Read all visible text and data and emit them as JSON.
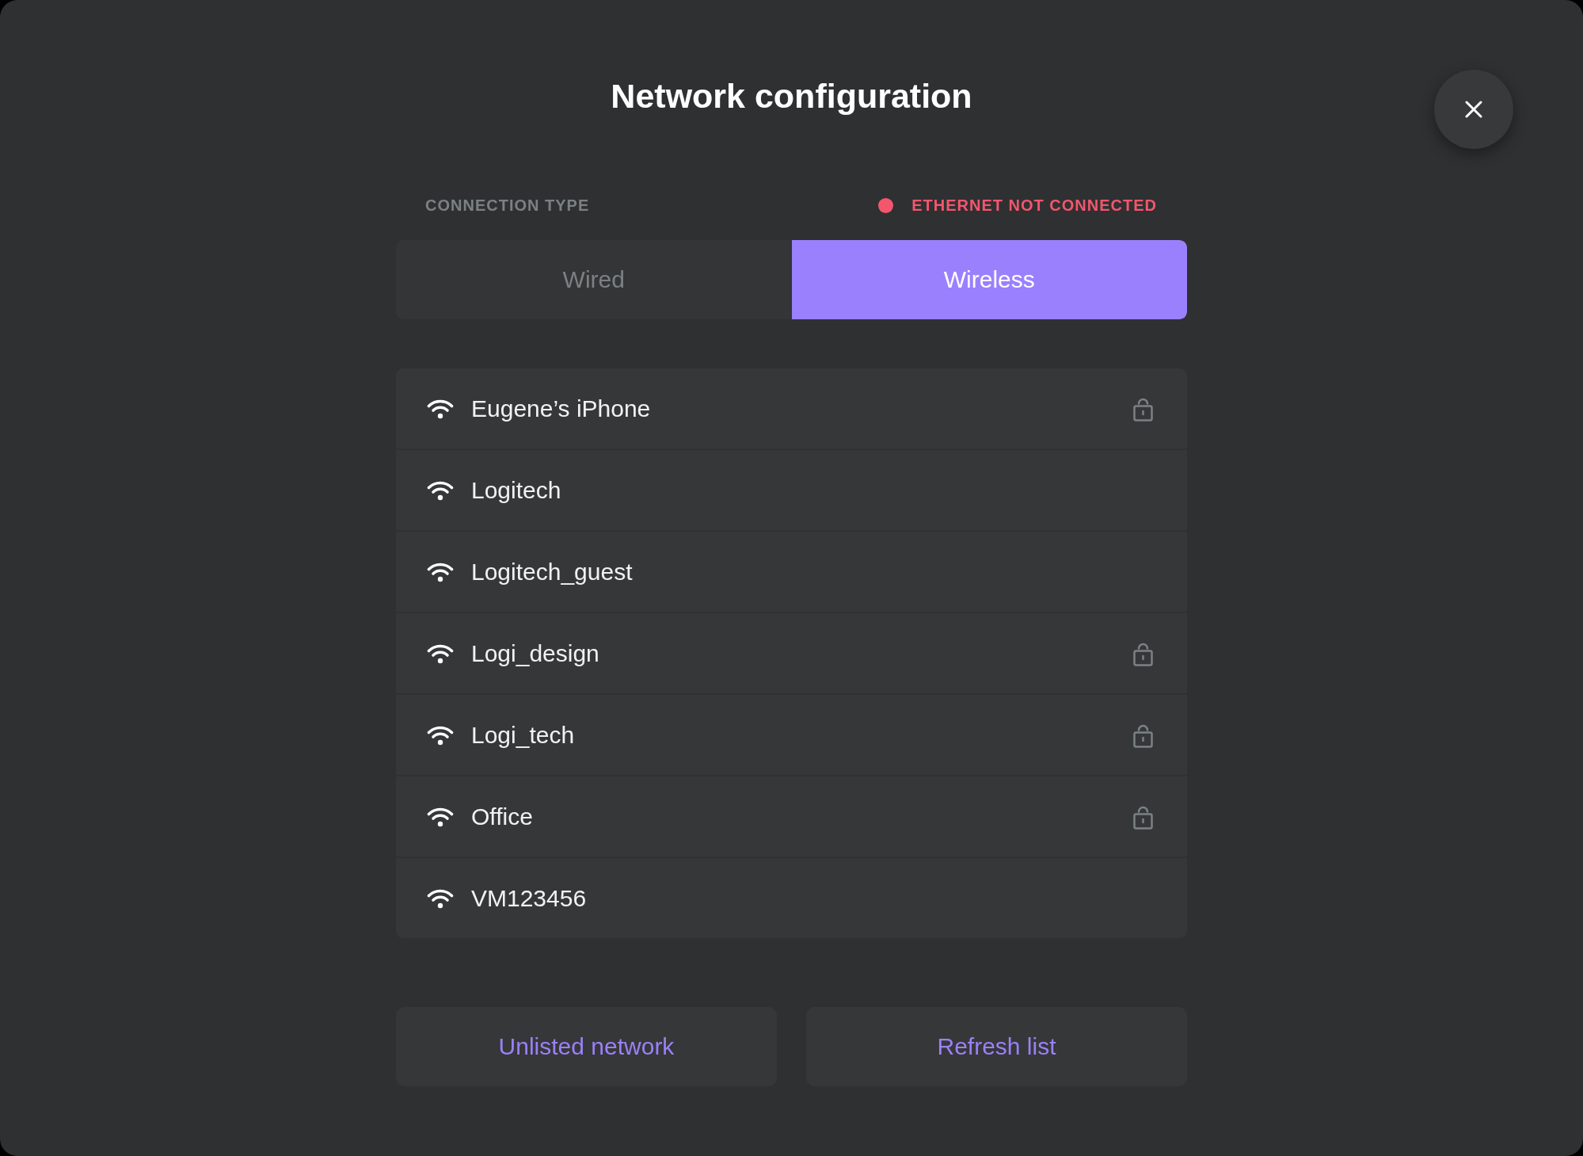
{
  "title": "Network configuration",
  "connection": {
    "label": "CONNECTION TYPE",
    "status": {
      "text": "ETHERNET NOT CONNECTED",
      "connected": false
    }
  },
  "tabs": [
    {
      "label": "Wired",
      "selected": false
    },
    {
      "label": "Wireless",
      "selected": true
    }
  ],
  "networks": [
    {
      "name": "Eugene’s iPhone",
      "secured": true
    },
    {
      "name": "Logitech",
      "secured": false
    },
    {
      "name": "Logitech_guest",
      "secured": false
    },
    {
      "name": "Logi_design",
      "secured": true
    },
    {
      "name": "Logi_tech",
      "secured": true
    },
    {
      "name": "Office",
      "secured": true
    },
    {
      "name": "VM123456",
      "secured": false
    }
  ],
  "buttons": [
    "Unlisted network",
    "Refresh list"
  ]
}
